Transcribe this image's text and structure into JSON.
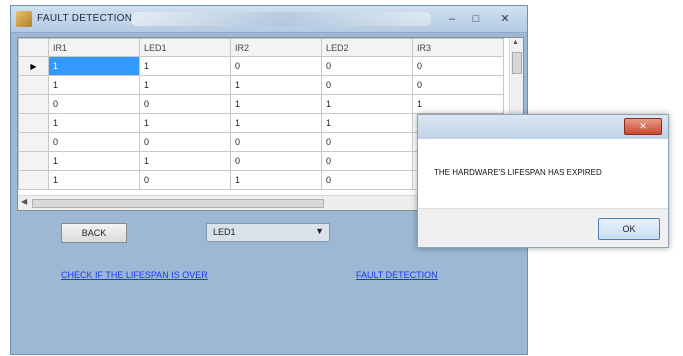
{
  "window": {
    "title": "FAULT DETECTION",
    "minimize_icon": "–",
    "maximize_icon": "□",
    "close_icon": "✕"
  },
  "grid": {
    "columns": [
      "IR1",
      "LED1",
      "IR2",
      "LED2",
      "IR3"
    ],
    "current_row_marker": "▶",
    "rows": [
      [
        "1",
        "1",
        "0",
        "0",
        "0"
      ],
      [
        "1",
        "1",
        "1",
        "0",
        "0"
      ],
      [
        "0",
        "0",
        "1",
        "1",
        "1"
      ],
      [
        "1",
        "1",
        "1",
        "1",
        ""
      ],
      [
        "0",
        "0",
        "0",
        "0",
        ""
      ],
      [
        "1",
        "1",
        "0",
        "0",
        ""
      ],
      [
        "1",
        "0",
        "1",
        "0",
        ""
      ]
    ]
  },
  "controls": {
    "back_label": "BACK",
    "dropdown_value": "LED1",
    "dropdown_icon": "▼",
    "check_link": "CHECK IF THE LIFESPAN IS OVER",
    "fault_link": "FAULT DETECTION"
  },
  "dialog": {
    "close_icon": "✕",
    "message": "THE HARDWARE'S LIFESPAN HAS EXPIRED",
    "ok_label": "OK"
  }
}
